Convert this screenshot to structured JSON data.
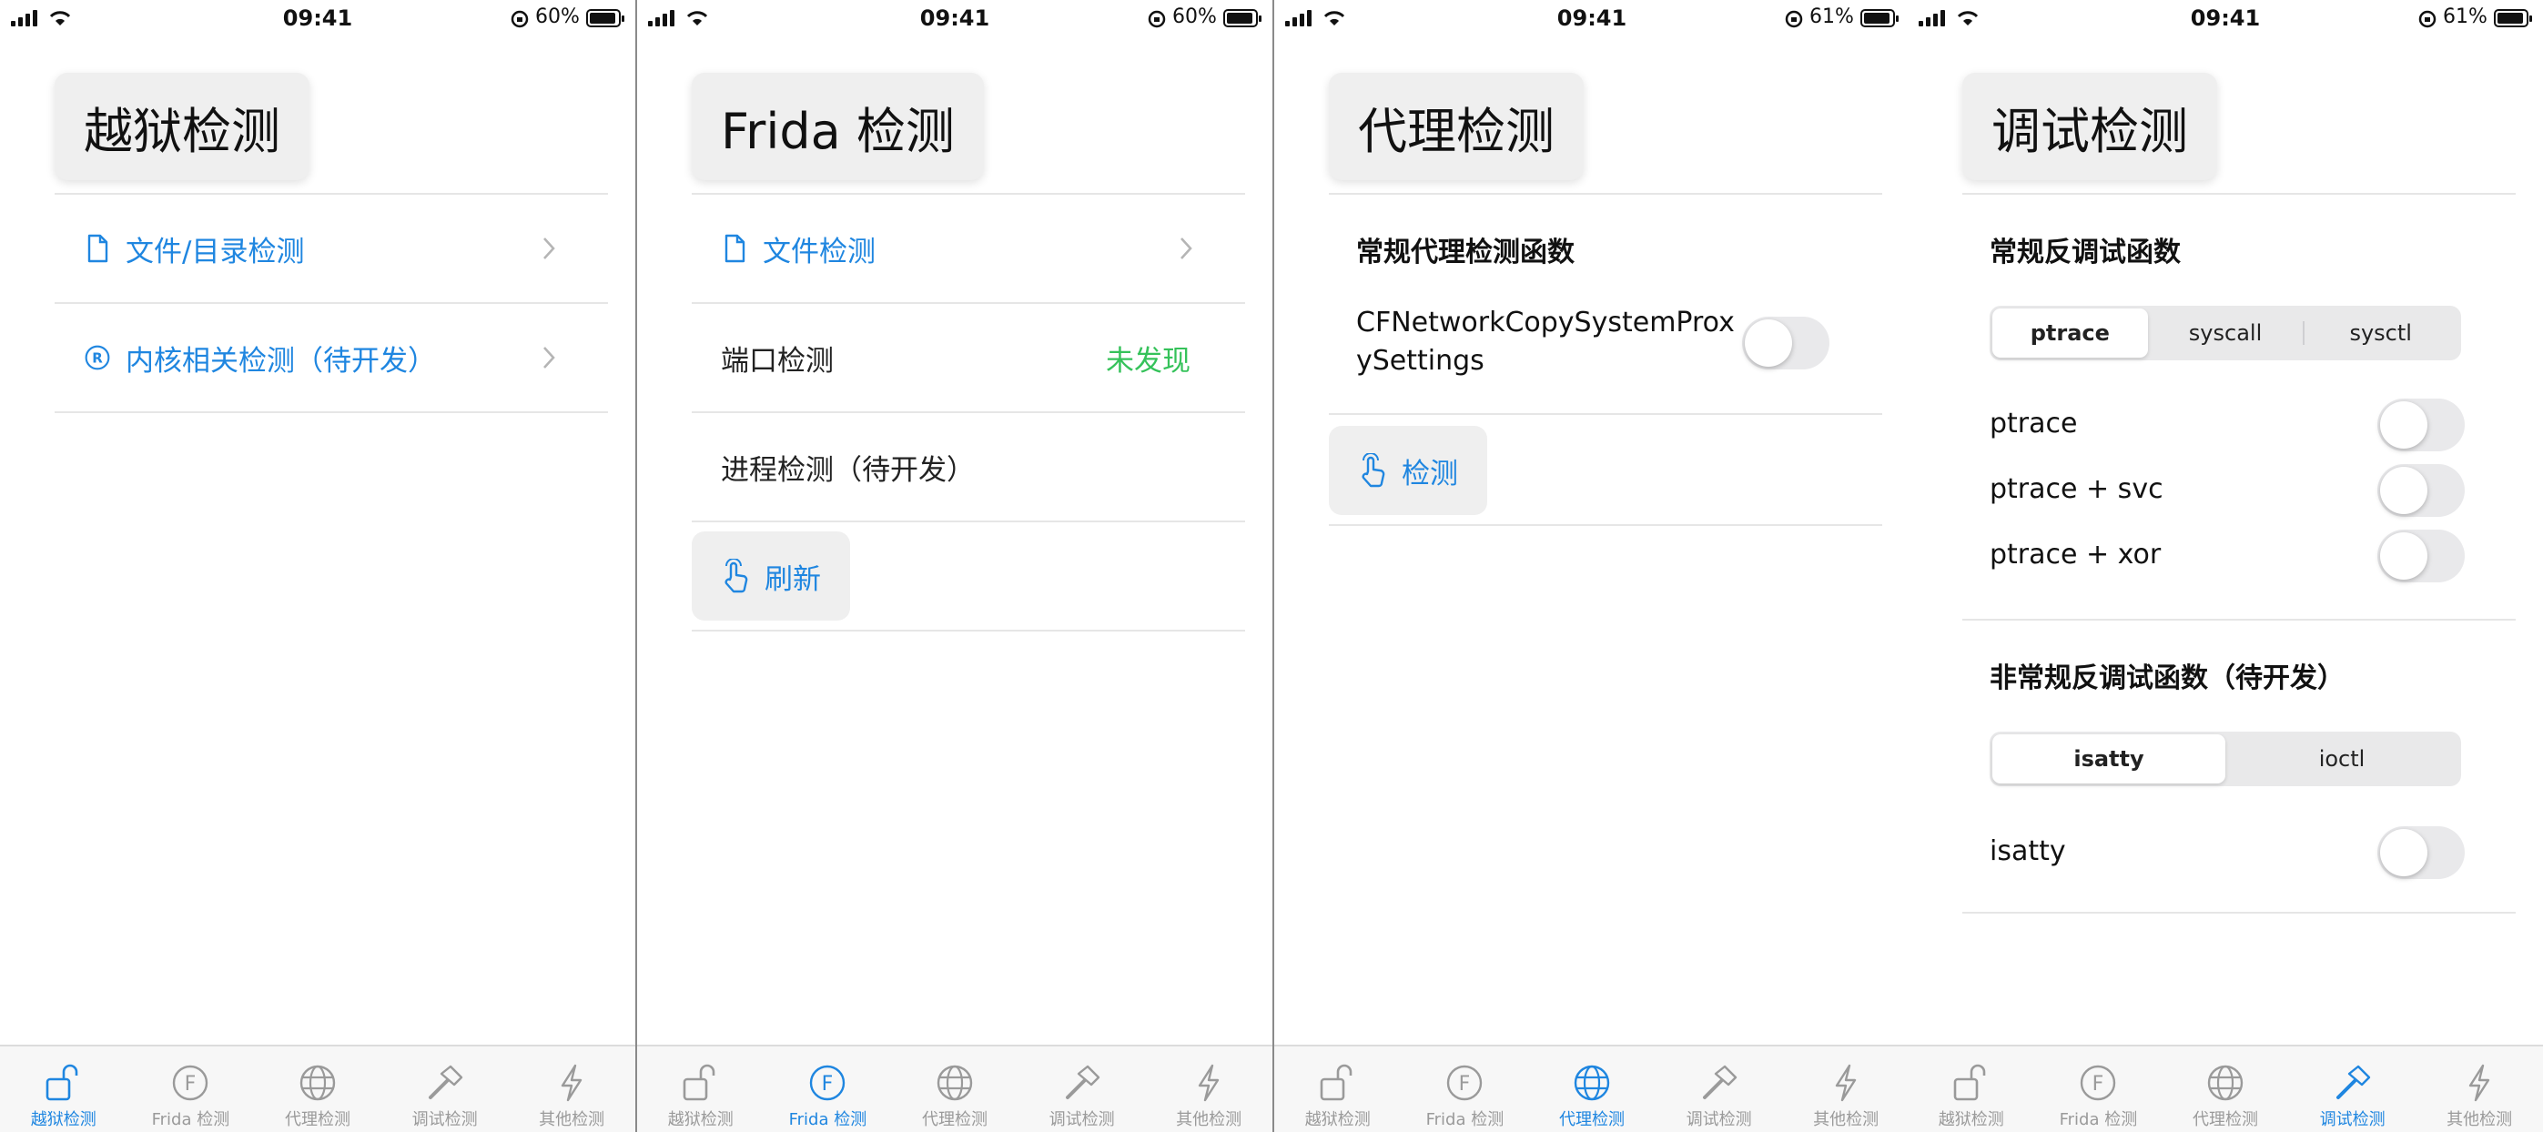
{
  "status_bars": [
    {
      "time": "09:41",
      "battery": "60%"
    },
    {
      "time": "09:41",
      "battery": "60%"
    },
    {
      "time": "09:41",
      "battery": "61%"
    },
    {
      "time": "09:41",
      "battery": "61%"
    }
  ],
  "tabs": [
    "越狱检测",
    "Frida 检测",
    "代理检测",
    "调试检测",
    "其他检测"
  ],
  "colors": {
    "accent": "#1f86e0",
    "status_ok": "#35c25a",
    "inactive": "#9a9a9a"
  },
  "screen1": {
    "title": "越狱检测",
    "items": [
      {
        "icon": "document-icon",
        "label": "文件/目录检测"
      },
      {
        "icon": "registered-icon",
        "label": "内核相关检测（待开发）"
      }
    ]
  },
  "screen2": {
    "title": "Frida 检测",
    "file_check": "文件检测",
    "port_check": "端口检测",
    "port_status": "未发现",
    "process_check": "进程检测（待开发）",
    "refresh": "刷新"
  },
  "screen3": {
    "title": "代理检测",
    "section": "常规代理检测函数",
    "toggle_label_line1": "CFNetworkCopySystemProx",
    "toggle_label_line2": "ySettings",
    "detect": "检测"
  },
  "screen4": {
    "title": "调试检测",
    "section1": "常规反调试函数",
    "seg1": [
      "ptrace",
      "syscall",
      "sysctl"
    ],
    "seg1_selected": "ptrace",
    "toggles1": [
      "ptrace",
      "ptrace + svc",
      "ptrace + xor"
    ],
    "section2": "非常规反调试函数（待开发）",
    "seg2": [
      "isatty",
      "ioctl"
    ],
    "seg2_selected": "isatty",
    "toggles2": [
      "isatty"
    ]
  }
}
